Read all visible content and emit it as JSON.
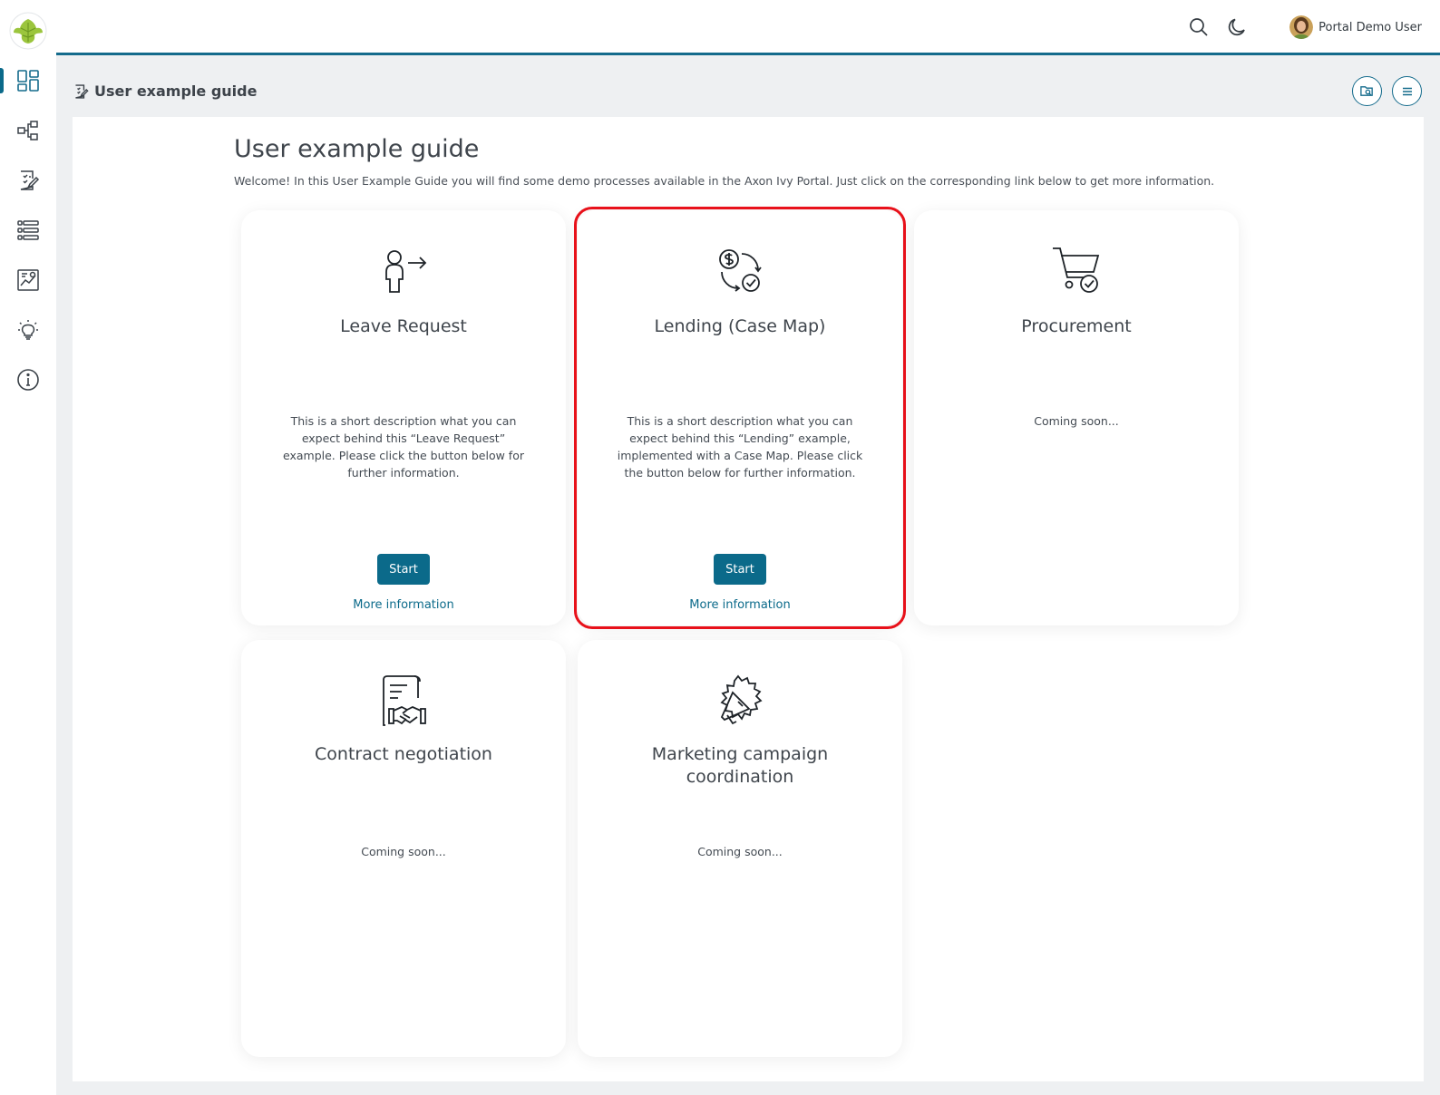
{
  "colors": {
    "accent": "#0b6a8a",
    "highlight": "#e8111a",
    "leaf": "#9bc53d"
  },
  "sidebar": {
    "logo_icon": "ivy-leaf-icon",
    "items": [
      {
        "icon": "dashboard-icon",
        "active": true
      },
      {
        "icon": "processes-icon"
      },
      {
        "icon": "tasks-icon"
      },
      {
        "icon": "cases-icon"
      },
      {
        "icon": "statistics-icon"
      },
      {
        "icon": "lightbulb-icon"
      },
      {
        "icon": "info-icon"
      }
    ]
  },
  "header": {
    "search_icon": "search-icon",
    "theme_icon": "moon-icon",
    "user_name": "Portal Demo User"
  },
  "breadcrumb": {
    "title": "User example guide"
  },
  "main": {
    "title": "User example guide",
    "intro": "Welcome! In this User Example Guide you will find some demo processes available in the Axon Ivy Portal. Just click on the corresponding link below to get more information.",
    "cards": [
      {
        "icon": "person-leave-icon",
        "title": "Leave Request",
        "description": "This is a short description what you can expect behind this “Leave Request” example. Please click the button below for further information.",
        "start_label": "Start",
        "more_label": "More information"
      },
      {
        "icon": "money-exchange-icon",
        "title": "Lending (Case Map)",
        "description": "This is a short description what you can expect behind this “Lending” example, implemented with a Case Map. Please click the button below for further information.",
        "start_label": "Start",
        "more_label": "More information",
        "highlighted": true
      },
      {
        "icon": "cart-check-icon",
        "title": "Procurement",
        "description": "Coming soon..."
      },
      {
        "icon": "contract-handshake-icon",
        "title": "Contract negotiation",
        "description": "Coming soon..."
      },
      {
        "icon": "megaphone-icon",
        "title": "Marketing campaign coordination",
        "description": "Coming soon..."
      }
    ]
  }
}
